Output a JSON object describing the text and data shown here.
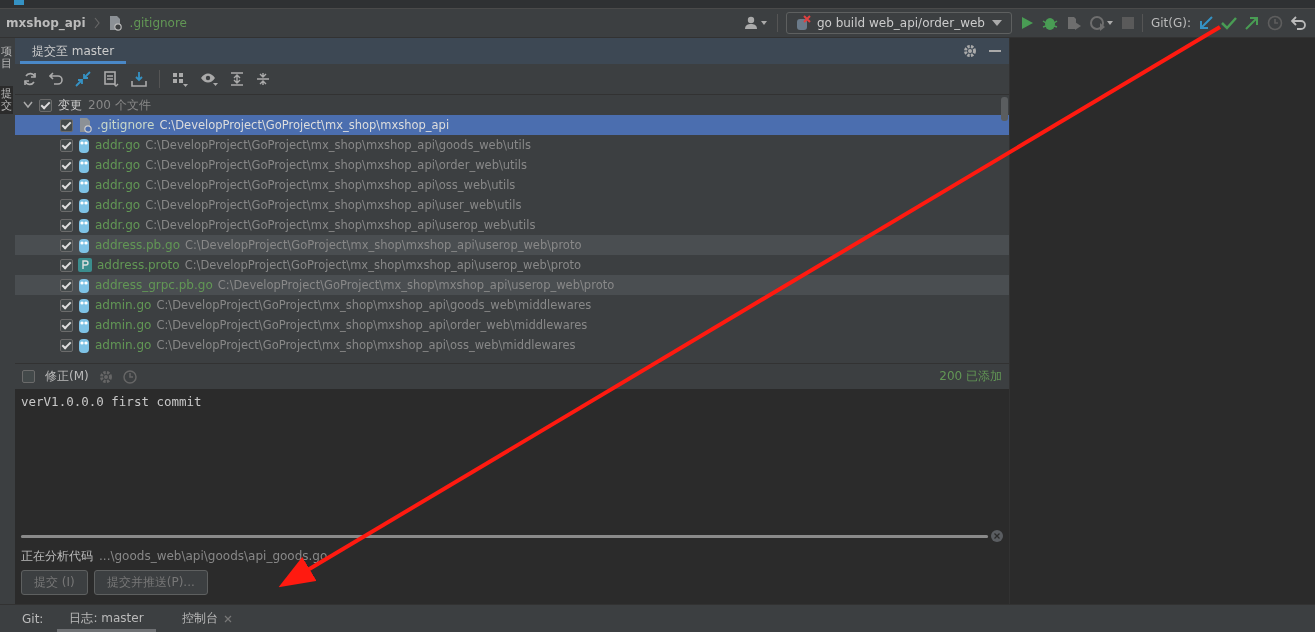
{
  "nav_bar": {
    "project": "mxshop_api",
    "file": ".gitignore",
    "run_config": "go build web_api/order_web",
    "git_label": "Git(G):"
  },
  "side_tabs": [
    {
      "label": "项目",
      "selected": false
    },
    {
      "label": "提交",
      "selected": true
    }
  ],
  "panel": {
    "tab": "提交至 master",
    "root": {
      "label": "变更",
      "count": "200 个文件",
      "checked": true,
      "expanded": true
    },
    "files": [
      {
        "name": ".gitignore",
        "path": "C:\\DevelopProject\\GoProject\\mx_shop\\mxshop_api",
        "kind": "ignore",
        "checked": true,
        "selected": true,
        "highlighted": false
      },
      {
        "name": "addr.go",
        "path": "C:\\DevelopProject\\GoProject\\mx_shop\\mxshop_api\\goods_web\\utils",
        "kind": "go",
        "checked": true,
        "selected": false,
        "highlighted": false
      },
      {
        "name": "addr.go",
        "path": "C:\\DevelopProject\\GoProject\\mx_shop\\mxshop_api\\order_web\\utils",
        "kind": "go",
        "checked": true,
        "selected": false,
        "highlighted": false
      },
      {
        "name": "addr.go",
        "path": "C:\\DevelopProject\\GoProject\\mx_shop\\mxshop_api\\oss_web\\utils",
        "kind": "go",
        "checked": true,
        "selected": false,
        "highlighted": false
      },
      {
        "name": "addr.go",
        "path": "C:\\DevelopProject\\GoProject\\mx_shop\\mxshop_api\\user_web\\utils",
        "kind": "go",
        "checked": true,
        "selected": false,
        "highlighted": false
      },
      {
        "name": "addr.go",
        "path": "C:\\DevelopProject\\GoProject\\mx_shop\\mxshop_api\\userop_web\\utils",
        "kind": "go",
        "checked": true,
        "selected": false,
        "highlighted": false
      },
      {
        "name": "address.pb.go",
        "path": "C:\\DevelopProject\\GoProject\\mx_shop\\mxshop_api\\userop_web\\proto",
        "kind": "go",
        "checked": true,
        "selected": false,
        "highlighted": true
      },
      {
        "name": "address.proto",
        "path": "C:\\DevelopProject\\GoProject\\mx_shop\\mxshop_api\\userop_web\\proto",
        "kind": "proto",
        "checked": true,
        "selected": false,
        "highlighted": false
      },
      {
        "name": "address_grpc.pb.go",
        "path": "C:\\DevelopProject\\GoProject\\mx_shop\\mxshop_api\\userop_web\\proto",
        "kind": "go",
        "checked": true,
        "selected": false,
        "highlighted": true
      },
      {
        "name": "admin.go",
        "path": "C:\\DevelopProject\\GoProject\\mx_shop\\mxshop_api\\goods_web\\middlewares",
        "kind": "go",
        "checked": true,
        "selected": false,
        "highlighted": false
      },
      {
        "name": "admin.go",
        "path": "C:\\DevelopProject\\GoProject\\mx_shop\\mxshop_api\\order_web\\middlewares",
        "kind": "go",
        "checked": true,
        "selected": false,
        "highlighted": false
      },
      {
        "name": "admin.go",
        "path": "C:\\DevelopProject\\GoProject\\mx_shop\\mxshop_api\\oss_web\\middlewares",
        "kind": "go",
        "checked": true,
        "selected": false,
        "highlighted": false
      }
    ],
    "amend": {
      "label": "修正(M)",
      "checked": false
    },
    "added": "200 已添加",
    "message": "verV1.0.0.0 first commit",
    "progress": {
      "level": 1
    },
    "status_label": "正在分析代码",
    "status_path": "...\\goods_web\\api\\goods\\api_goods.go",
    "buttons": [
      {
        "label": "提交 (I)"
      },
      {
        "label": "提交并推送(P)..."
      }
    ]
  },
  "bottom_bar": {
    "label": "Git:",
    "tabs": [
      {
        "label": "日志: master",
        "selected": true,
        "closable": false
      },
      {
        "label": "控制台",
        "selected": false,
        "closable": true
      }
    ]
  }
}
